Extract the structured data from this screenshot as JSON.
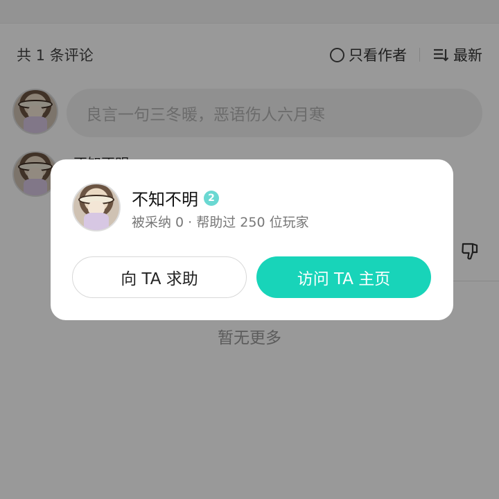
{
  "comments": {
    "count_text": "共 1 条评论",
    "author_only_label": "只看作者",
    "sort_label": "最新",
    "input_placeholder": "良言一句三冬暖，恶语伤人六月寒",
    "commenter_name": "不知不明",
    "no_more_text": "暂无更多"
  },
  "dialog": {
    "user_name": "不知不明",
    "level": "2",
    "stats_text": "被采纳 0 · 帮助过 250 位玩家",
    "help_button_label": "向 TA 求助",
    "visit_button_label": "访问 TA 主页"
  },
  "colors": {
    "accent": "#18d4b9",
    "level_badge": "#6ad8d2",
    "overlay": "rgba(0,0,0,0.4)"
  },
  "icons": {
    "author_only": "circle-icon",
    "sort": "sort-icon",
    "dislike": "thumbs-down-icon"
  }
}
